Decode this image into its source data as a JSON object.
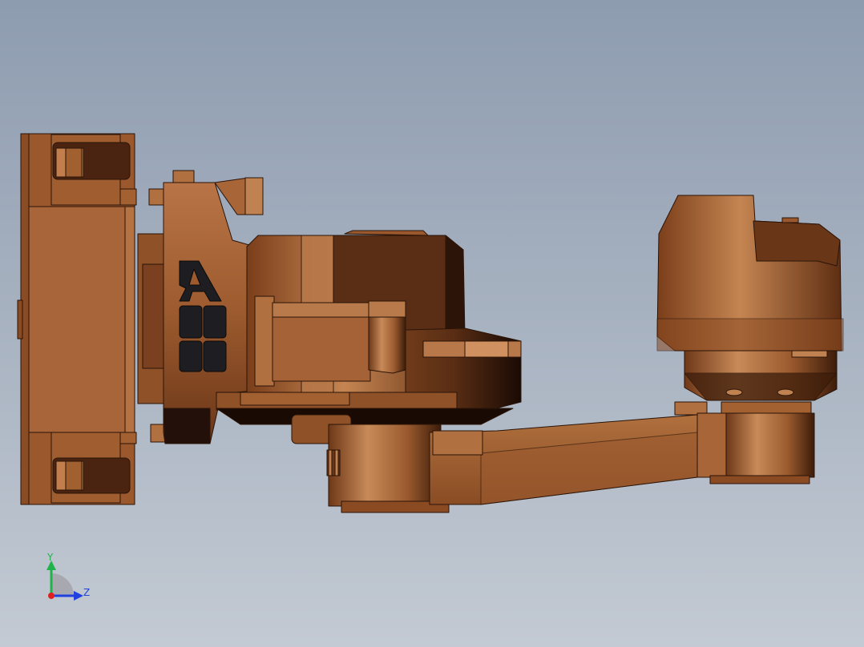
{
  "model": {
    "logo_text": "ABB",
    "colors": {
      "body_mid": "#9c5a2e",
      "body_light": "#c2804f",
      "body_dark": "#5a2e14",
      "edge": "#2a1408",
      "logo": "#1e1e22"
    }
  },
  "triad": {
    "y_label": "Y",
    "z_label": "Z",
    "colors": {
      "y": "#22b24c",
      "z": "#2040e0",
      "x": "#e02020"
    }
  }
}
